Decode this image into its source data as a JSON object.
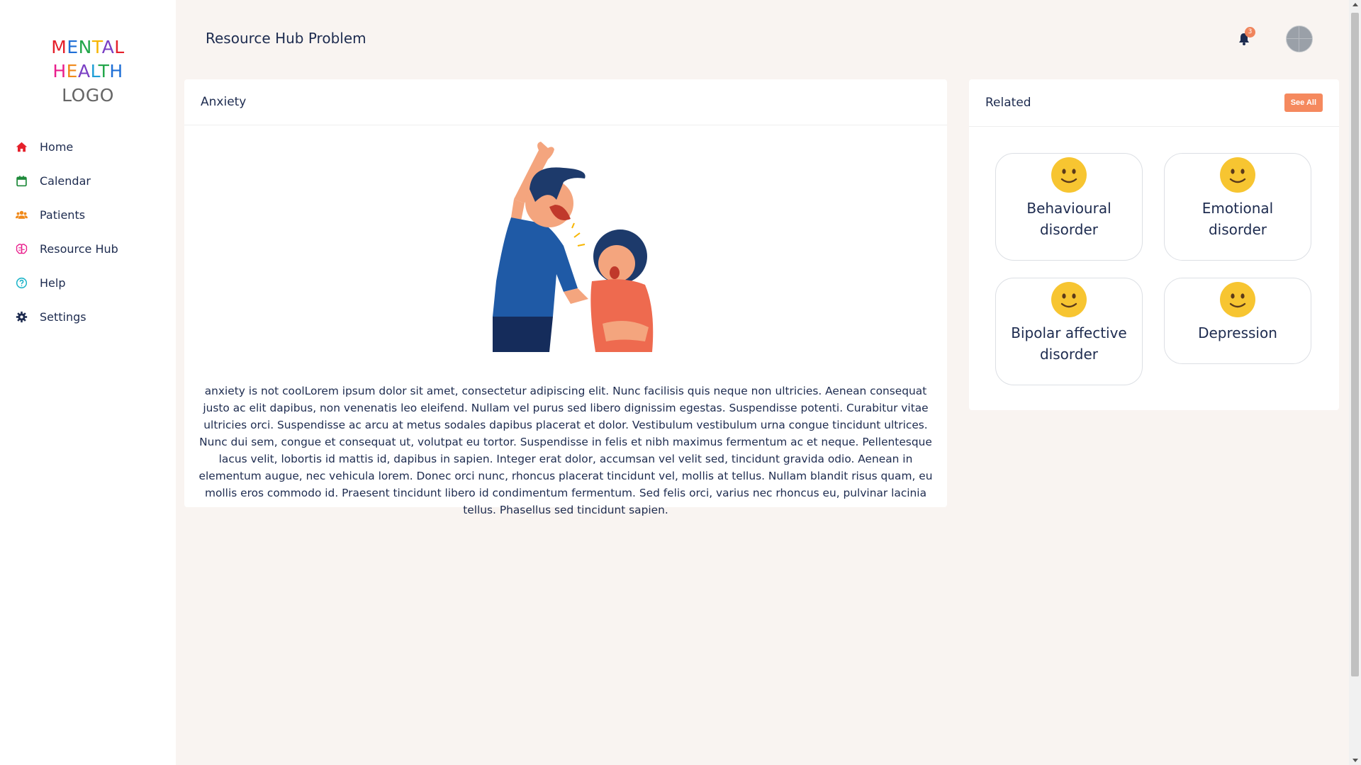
{
  "logo": {
    "line1": [
      "M",
      "E",
      "N",
      "T",
      "A",
      "L"
    ],
    "line1_colors": [
      "#e5202b",
      "#1f6fd6",
      "#22a64a",
      "#f7b500",
      "#7a3fc4",
      "#e5202b"
    ],
    "line2": [
      "H",
      "E",
      "A",
      "L",
      "T",
      "H"
    ],
    "line2_colors": [
      "#e91e8c",
      "#f08a1c",
      "#7a3fc4",
      "#1f9ed6",
      "#22a64a",
      "#1f6fd6"
    ],
    "line3": "LOGO"
  },
  "sidebar": {
    "items": [
      {
        "label": "Home",
        "icon": "home-icon",
        "color": "#e5202b"
      },
      {
        "label": "Calendar",
        "icon": "calendar-icon",
        "color": "#1e8a3a"
      },
      {
        "label": "Patients",
        "icon": "users-icon",
        "color": "#f08a1c"
      },
      {
        "label": "Resource Hub",
        "icon": "brain-icon",
        "color": "#e91e8c"
      },
      {
        "label": "Help",
        "icon": "help-icon",
        "color": "#1fb5c9"
      },
      {
        "label": "Settings",
        "icon": "gear-icon",
        "color": "#1d2b4f"
      }
    ]
  },
  "header": {
    "title": "Resource Hub Problem",
    "notification_count": "3"
  },
  "article": {
    "title": "Anxiety",
    "body": "anxiety is not coolLorem ipsum dolor sit amet, consectetur adipiscing elit. Nunc facilisis quis neque non ultricies. Aenean consequat justo ac elit dapibus, non venenatis leo eleifend. Nullam vel purus sed libero dignissim egestas. Suspendisse potenti. Curabitur vitae ultricies orci. Suspendisse ac arcu at metus sodales dapibus placerat et dolor. Vestibulum vestibulum urna congue tincidunt ultrices. Nunc dui sem, congue et consequat ut, volutpat eu tortor. Suspendisse in felis et nibh maximus fermentum ac et neque. Pellentesque lacus velit, lobortis id mattis id, dapibus in sapien. Integer erat dolor, accumsan vel velit sed, tincidunt gravida odio. Aenean in elementum augue, nec vehicula lorem. Donec orci nunc, rhoncus placerat tincidunt vel, mollis at tellus. Nullam blandit risus quam, eu mollis eros commodo id. Praesent tincidunt libero id condimentum fermentum. Sed felis orci, varius nec rhoncus eu, pulvinar lacinia tellus. Phasellus sed tincidunt sapien."
  },
  "related": {
    "title": "Related",
    "see_all": "See All",
    "tiles": [
      {
        "line1": "Behavioural",
        "line2": "disorder",
        "icon": "smiley-icon"
      },
      {
        "line1": "Emotional",
        "line2": "disorder",
        "icon": "smiley-icon"
      },
      {
        "line1": "Bipolar affective",
        "line2": "disorder",
        "icon": "smiley-icon"
      },
      {
        "line1": "Depression",
        "line2": "",
        "icon": "smiley-icon"
      }
    ]
  },
  "colors": {
    "accent": "#f5895e",
    "text": "#1d2b4f",
    "background": "#f9f4f1"
  }
}
